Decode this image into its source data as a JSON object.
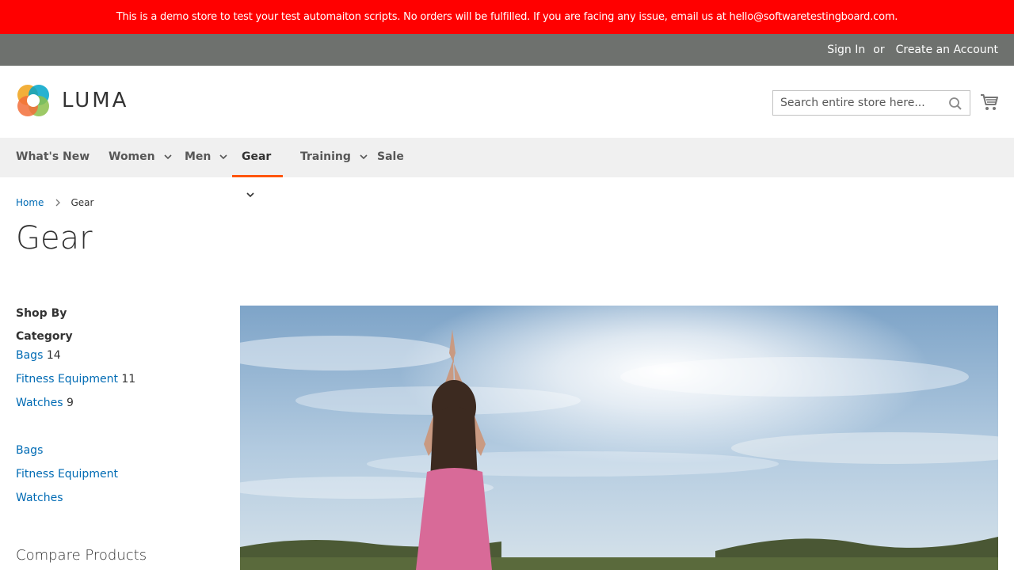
{
  "banner": {
    "text": "This is a demo store to test your test automaiton scripts. No orders will be fulfilled. If you are facing any issue, email us at hello@softwaretestingboard.com."
  },
  "topbar": {
    "sign_in": "Sign In",
    "or": "or",
    "create_account": "Create an Account"
  },
  "header": {
    "logo_text": "LUMA",
    "search_placeholder": "Search entire store here...",
    "icons": {
      "search": "search-icon",
      "cart": "cart-icon"
    }
  },
  "nav": {
    "items": [
      {
        "label": "What's New",
        "has_dropdown": false
      },
      {
        "label": "Women",
        "has_dropdown": true
      },
      {
        "label": "Men",
        "has_dropdown": true
      },
      {
        "label": "Gear",
        "has_dropdown": true,
        "active": true
      },
      {
        "label": "Training",
        "has_dropdown": true
      },
      {
        "label": "Sale",
        "has_dropdown": false
      }
    ]
  },
  "breadcrumb": {
    "home": "Home",
    "current": "Gear"
  },
  "page": {
    "title": "Gear"
  },
  "sidebar": {
    "shop_by": "Shop By",
    "category_title": "Category",
    "filters": [
      {
        "label": "Bags",
        "count": "14"
      },
      {
        "label": "Fitness Equipment",
        "count": "11"
      },
      {
        "label": "Watches",
        "count": "9"
      }
    ],
    "categories": [
      "Bags",
      "Fitness Equipment",
      "Watches"
    ],
    "compare_title": "Compare Products"
  },
  "colors": {
    "banner_bg": "#ff0000",
    "topbar_bg": "#6e716e",
    "nav_bg": "#f0f0f0",
    "nav_active_underline": "#ff5501",
    "link": "#006bb4"
  }
}
